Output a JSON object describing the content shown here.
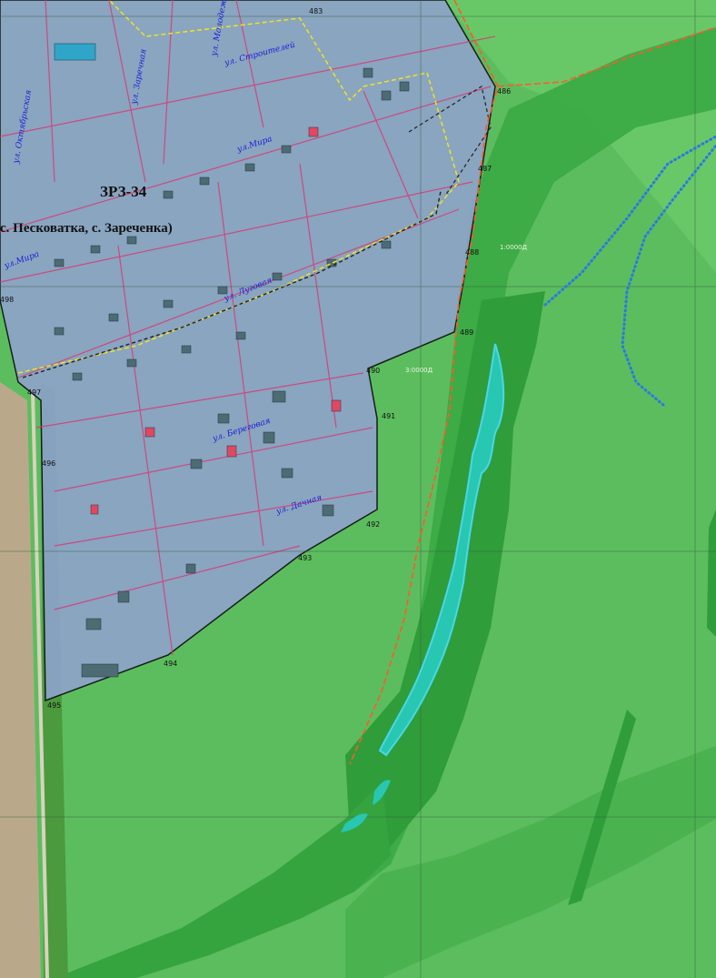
{
  "zone": {
    "title": "ЗРЗ-34",
    "subtitle": "с. Песковатка, с. Зареченка)"
  },
  "streets": [
    {
      "id": "mira-1",
      "label": "ул.Мира"
    },
    {
      "id": "mira-2",
      "label": "ул.Мира"
    },
    {
      "id": "lugovaya",
      "label": "ул. Луговая"
    },
    {
      "id": "beregovaya",
      "label": "ул. Береговая"
    },
    {
      "id": "dachnaya",
      "label": "ул. Дачная"
    },
    {
      "id": "stroiteley",
      "label": "ул. Строителей"
    },
    {
      "id": "oktyabrskaya",
      "label": "ул. Октябрьская"
    },
    {
      "id": "zarechnaya",
      "label": "ул. Заречная"
    },
    {
      "id": "molodezhnaya",
      "label": "ул. Молодежная"
    }
  ],
  "boundary_points": [
    "483",
    "486",
    "487",
    "488",
    "489",
    "490",
    "491",
    "492",
    "493",
    "494",
    "495",
    "496",
    "497",
    "498"
  ],
  "map_codes": [
    "1:0000Д",
    "3:0000Д"
  ],
  "colors": {
    "green_zone": "#5cbd5e",
    "dark_green_band": "#2ea23c",
    "settlement_zone": "#8da3c9",
    "water_cyan": "#27c7b2",
    "red_line": "#ff5a2a",
    "blue_dotted": "#2a7ae0",
    "road_line": "#e4246b",
    "yellow_dashed": "#f2e21f"
  }
}
